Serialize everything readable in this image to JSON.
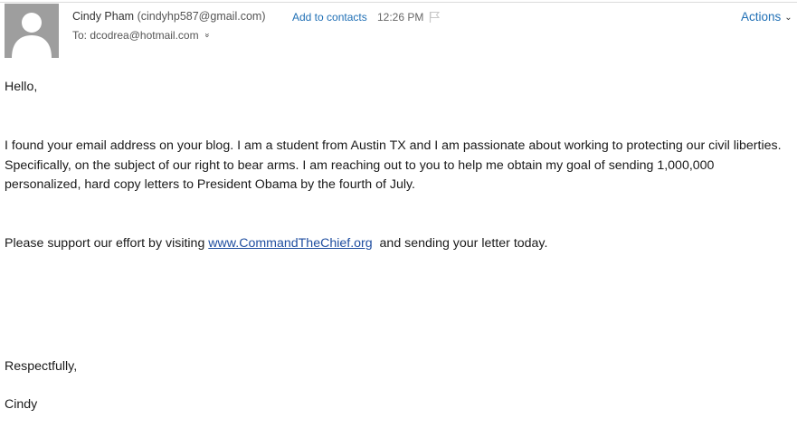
{
  "header": {
    "sender_name": "Cindy Pham",
    "sender_email": "(cindyhp587@gmail.com)",
    "add_to_contacts": "Add to contacts",
    "time": "12:26 PM",
    "to_prefix": "To:",
    "to_address": "dcodrea@hotmail.com",
    "expand_glyph": "»",
    "actions_label": "Actions",
    "actions_caret": "⌵"
  },
  "message": {
    "greeting": "Hello,",
    "paragraph1": "I found your email address on your blog. I am a student from Austin TX and I am passionate about working to protecting our civil liberties. Specifically, on the subject of our right to bear arms.  I am reaching out to you to help me obtain my goal of sending 1,000,000 personalized, hard copy letters to President Obama by the fourth of July.",
    "paragraph2_before": "Please support our effort by visiting ",
    "link_text": "www.CommandTheChief.org",
    "paragraph2_after": "  and sending your letter today.",
    "closing": "Respectfully,",
    "signature": "Cindy"
  },
  "icons": {
    "avatar": "default-person-avatar",
    "flag": "flag-icon"
  },
  "colors": {
    "link": "#1f6fb5",
    "avatar_bg": "#9e9e9e"
  }
}
